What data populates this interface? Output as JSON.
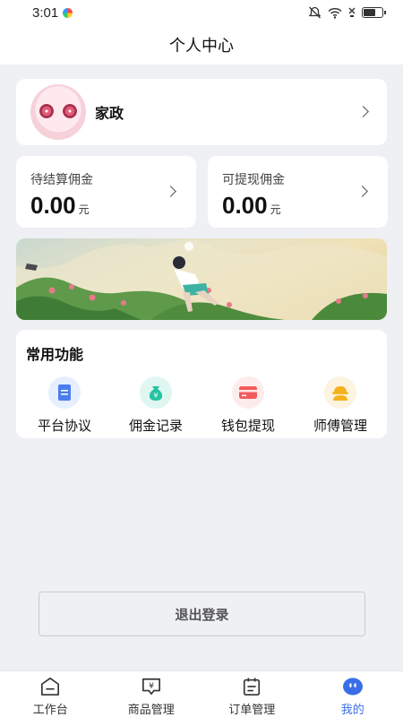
{
  "status_bar": {
    "time": "3:01"
  },
  "nav": {
    "title": "个人中心"
  },
  "profile": {
    "name": "家政"
  },
  "commission": {
    "pending": {
      "label": "待结算佣金",
      "value": "0.00",
      "unit": "元"
    },
    "withdrawable": {
      "label": "可提现佣金",
      "value": "0.00",
      "unit": "元"
    }
  },
  "functions": {
    "title": "常用功能",
    "items": [
      {
        "label": "平台协议",
        "icon": "document-icon",
        "color": "#4a7df0",
        "bg": "#e6efff"
      },
      {
        "label": "佣金记录",
        "icon": "money-bag-icon",
        "color": "#23c3a3",
        "bg": "#e0f7f1"
      },
      {
        "label": "钱包提现",
        "icon": "wallet-card-icon",
        "color": "#f25b5b",
        "bg": "#fdecec"
      },
      {
        "label": "师傅管理",
        "icon": "worker-helmet-icon",
        "color": "#f6b11c",
        "bg": "#fdf4e0"
      }
    ]
  },
  "logout": {
    "label": "退出登录"
  },
  "tabbar": {
    "items": [
      {
        "label": "工作台",
        "icon": "home-icon"
      },
      {
        "label": "商品管理",
        "icon": "product-icon"
      },
      {
        "label": "订单管理",
        "icon": "calendar-icon"
      },
      {
        "label": "我的",
        "icon": "profile-face-icon",
        "active": true
      }
    ],
    "accent": "#3a6ee8"
  }
}
